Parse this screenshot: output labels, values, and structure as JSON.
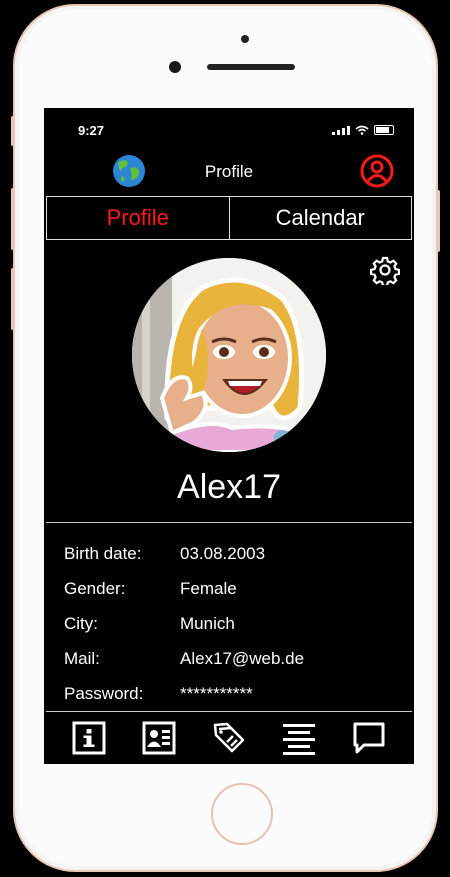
{
  "status_bar": {
    "time": "9:27"
  },
  "header": {
    "title": "Profile"
  },
  "tabs": [
    {
      "label": "Profile",
      "active": true
    },
    {
      "label": "Calendar",
      "active": false
    }
  ],
  "profile": {
    "username": "Alex17"
  },
  "details": [
    {
      "label": "Birth date:",
      "value": "03.08.2003"
    },
    {
      "label": "Gender:",
      "value": "Female"
    },
    {
      "label": "City:",
      "value": "Munich"
    },
    {
      "label": "Mail:",
      "value": "Alex17@web.de"
    },
    {
      "label": "Password:",
      "value": "***********"
    }
  ],
  "icons": {
    "header_left": "globe-icon",
    "header_right": "user-circle-icon",
    "settings": "gear-icon",
    "nav": [
      "info-icon",
      "contact-card-icon",
      "tags-icon",
      "list-icon",
      "chat-icon"
    ]
  },
  "colors": {
    "accent": "#ff1a1a",
    "background": "#000000",
    "text": "#ffffff"
  }
}
